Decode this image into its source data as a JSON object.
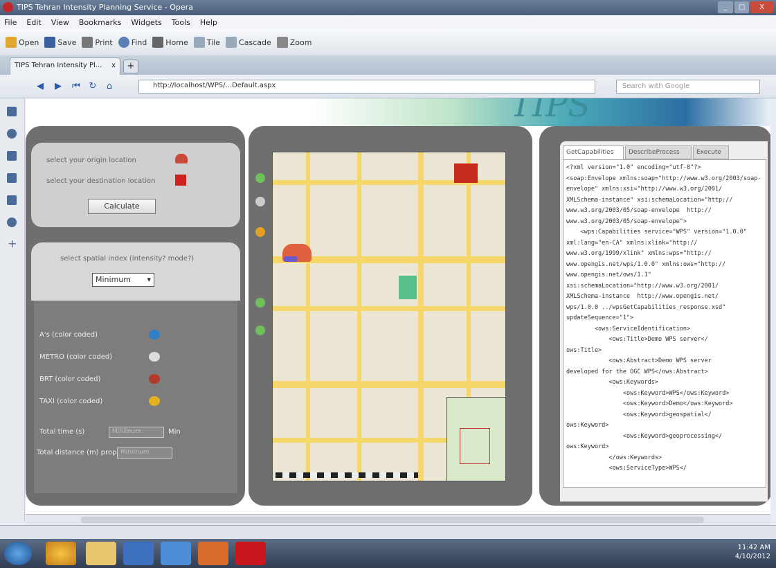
{
  "window": {
    "title": "TIPS Tehran Intensity Planning Service - Opera",
    "min": "_",
    "max": "□",
    "close": "X"
  },
  "menu": [
    "File",
    "Edit",
    "View",
    "Bookmarks",
    "Widgets",
    "Tools",
    "Help"
  ],
  "toolbar": [
    "Open",
    "Save",
    "Print",
    "Find",
    "Home",
    "Tile",
    "Cascade",
    "Zoom"
  ],
  "tab": {
    "label": "TIPS Tehran Intensity Pl...",
    "close": "x",
    "new": "+"
  },
  "address": {
    "url": "http://localhost/WPS/...Default.aspx",
    "search_placeholder": "Search with Google"
  },
  "left": {
    "start_label": "select your origin location",
    "dest_label": "select your destination location",
    "calc_button": "Calculate",
    "mode_label": "select spatial index (intensity? mode?)",
    "mode_value": "Minimum",
    "legend": [
      "A's (color coded)",
      "METRO (color coded)",
      "BRT (color coded)",
      "TAXI (color coded)"
    ],
    "f1_label": "Total time (s)",
    "f1_value": "Minimum",
    "f1_unit": "Min",
    "f2_label": "Total distance (m) proposed",
    "f2_value": "Minimum"
  },
  "right": {
    "tabs": [
      "GetCapabilities",
      "DescribeProcess",
      "Execute"
    ],
    "xml": "<?xml version=\"1.0\" encoding=\"utf-8\"?>\n<soap:Envelope xmlns:soap=\"http://www.w3.org/2003/soap-\nenvelope\" xmlns:xsi=\"http://www.w3.org/2001/\nXMLSchema-instance\" xsi:schemaLocation=\"http://\nwww.w3.org/2003/05/soap-envelope  http://\nwww.w3.org/2003/05/soap-envelope\">\n    <wps:Capabilities service=\"WPS\" version=\"1.0.0\"\nxml:lang=\"en-CA\" xmlns:xlink=\"http://\nwww.w3.org/1999/xlink\" xmlns:wps=\"http://\nwww.opengis.net/wps/1.0.0\" xmlns:ows=\"http://\nwww.opengis.net/ows/1.1\"\nxsi:schemaLocation=\"http://www.w3.org/2001/\nXMLSchema-instance  http://www.opengis.net/\nwps/1.0.0 ../wpsGetCapabilities_response.xsd\"\nupdateSequence=\"1\">\n        <ows:ServiceIdentification>\n            <ows:Title>Demo WPS server</\nows:Title>\n            <ows:Abstract>Demo WPS server\ndeveloped for the OGC WPS</ows:Abstract>\n            <ows:Keywords>\n                <ows:Keyword>WPS</ows:Keyword>\n                <ows:Keyword>Demo</ows:Keyword>\n                <ows:Keyword>geospatial</\nows:Keyword>\n                <ows:Keyword>geoprocessing</\nows:Keyword>\n            </ows:Keywords>\n            <ows:ServiceType>WPS</"
  },
  "banner": {
    "logo": "TIPS"
  },
  "taskbar": {
    "time": "11:42 AM",
    "date": "4/10/2012"
  },
  "colors": {
    "panel": "#6f6f6f",
    "road": "#f5d76a",
    "banner": "#3a8f9a"
  }
}
